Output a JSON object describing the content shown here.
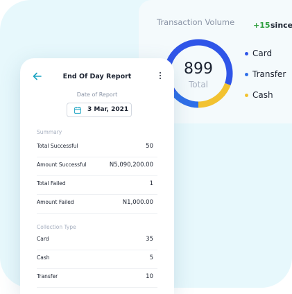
{
  "volume": {
    "title": "Transaction Volume",
    "delta": "+15",
    "since": "since",
    "total_value": "899",
    "total_label": "Total",
    "legend": [
      {
        "label": "Card",
        "color": "#2f55e8"
      },
      {
        "label": "Transfer",
        "color": "#2f6fe8"
      },
      {
        "label": "Cash",
        "color": "#f2c230"
      }
    ]
  },
  "report": {
    "title": "End Of Day Report",
    "date_label": "Date of Report",
    "date_value": "3 Mar, 2021",
    "summary_label": "Summary",
    "summary": [
      {
        "label": "Total Successful",
        "value": "50"
      },
      {
        "label": "Amount Successful",
        "value": "N5,090,200.00"
      },
      {
        "label": "Total Failed",
        "value": "1"
      },
      {
        "label": "Amount Failed",
        "value": "N1,000.00"
      }
    ],
    "collection_label": "Collection Type",
    "collection": [
      {
        "label": "Card",
        "value": "35"
      },
      {
        "label": "Cash",
        "value": "5"
      },
      {
        "label": "Transfer",
        "value": "10"
      }
    ]
  }
}
